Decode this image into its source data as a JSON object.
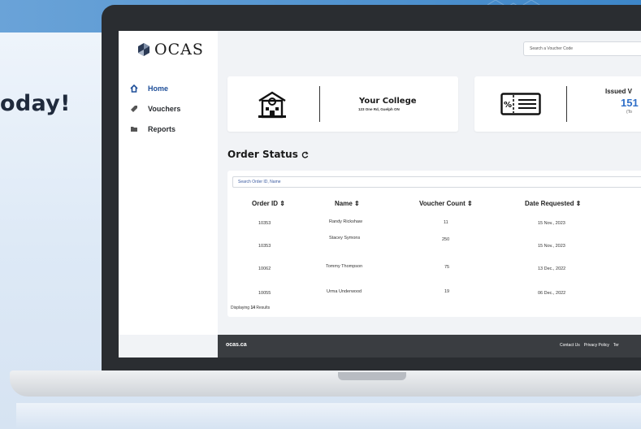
{
  "hero": {
    "text": "oday!"
  },
  "app": {
    "logo": "OCAS"
  },
  "sidebar": {
    "items": [
      {
        "label": "Home",
        "icon": "home-icon",
        "active": true
      },
      {
        "label": "Vouchers",
        "icon": "tag-icon",
        "active": false
      },
      {
        "label": "Reports",
        "icon": "folder-icon",
        "active": false
      }
    ]
  },
  "header": {
    "search_placeholder": "Search a Voucher Code"
  },
  "college_card": {
    "name": "Your College",
    "address": "123 One Rd, Guelph ON",
    "icon": "school-building-icon"
  },
  "issued_card": {
    "label": "Issued V",
    "value": "151",
    "sub": "(To",
    "icon": "voucher-ticket-icon"
  },
  "orders": {
    "title": "Order Status",
    "refresh_icon": "refresh-icon",
    "search_placeholder": "Search Order ID, Name",
    "columns": [
      "Order ID ⇕",
      "Name ⇕",
      "Voucher Count ⇕",
      "Date Requested ⇕"
    ],
    "rows": [
      {
        "id": "10353",
        "name": "Randy Rickshaw",
        "count": "11",
        "date": "15 Nov., 2023"
      },
      {
        "id": "10353",
        "name": "Stacey Symons",
        "count": "250",
        "date": "15 Nov., 2023"
      },
      {
        "id": "10062",
        "name": "Tommy Thompson",
        "count": "75",
        "date": "13 Dec., 2022"
      },
      {
        "id": "10055",
        "name": "Urma Underwood",
        "count": "19",
        "date": "06 Dec., 2022"
      }
    ],
    "footer_prefix": "Displaying ",
    "footer_count": "14",
    "footer_suffix": " Results"
  },
  "footer": {
    "brand": "ocas.ca",
    "links": [
      "Contact Us",
      "Privacy Policy",
      "Ter"
    ]
  },
  "colors": {
    "accent": "#1f4f99",
    "value": "#2f6fc8",
    "footer": "#3a3d41"
  }
}
